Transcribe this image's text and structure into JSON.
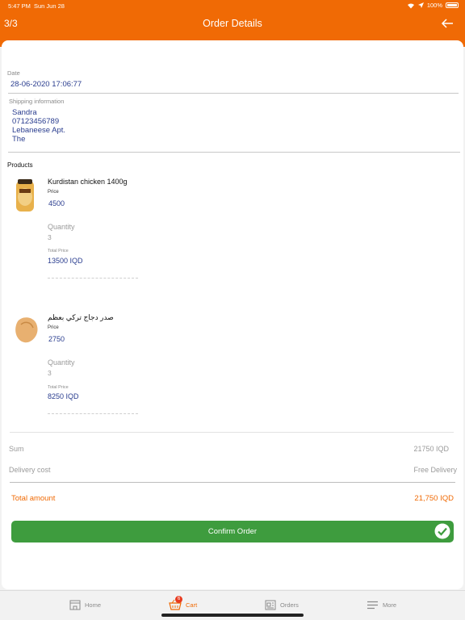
{
  "status_bar": {
    "time": "5:47 PM",
    "day": "Sun Jun 28",
    "battery": "100%"
  },
  "header": {
    "step": "3/3",
    "title": "Order Details"
  },
  "order": {
    "date_label": "Date",
    "date": "28-06-2020 17:06:77",
    "shipping_label": "Shipping information",
    "shipping_lines": [
      "Sandra",
      "07123456789",
      "Lebaneese Apt.",
      "The"
    ],
    "products_label": "Products"
  },
  "products": [
    {
      "name": "Kurdistan chicken  1400g",
      "price_label": "Price",
      "price": "4500",
      "quantity_label": "Quantity",
      "quantity": "3",
      "total_label": "Total Price",
      "total": "13500 IQD",
      "image_icon": "frozen-chicken-package"
    },
    {
      "name": "صدر دجاج  تركي بعظم",
      "price_label": "Price",
      "price": "2750",
      "quantity_label": "Quantity",
      "quantity": "3",
      "total_label": "Total Price",
      "total": "8250 IQD",
      "image_icon": "chicken-breast"
    }
  ],
  "summary": {
    "sum_label": "Sum",
    "sum_value": "21750 IQD",
    "delivery_label": "Delivery cost",
    "delivery_value": "Free Delivery",
    "total_label": "Total amount",
    "total_value": "21,750 IQD"
  },
  "confirm_label": "Confirm Order",
  "tabs": [
    {
      "label": "Home",
      "icon": "store-icon"
    },
    {
      "label": "Cart",
      "icon": "basket-icon",
      "badge": "6"
    },
    {
      "label": "Orders",
      "icon": "orders-icon"
    },
    {
      "label": "More",
      "icon": "menu-icon"
    }
  ],
  "colors": {
    "brand": "#f06a05",
    "accent_blue": "#2a3d8f",
    "confirm_green": "#3e9c3e"
  }
}
